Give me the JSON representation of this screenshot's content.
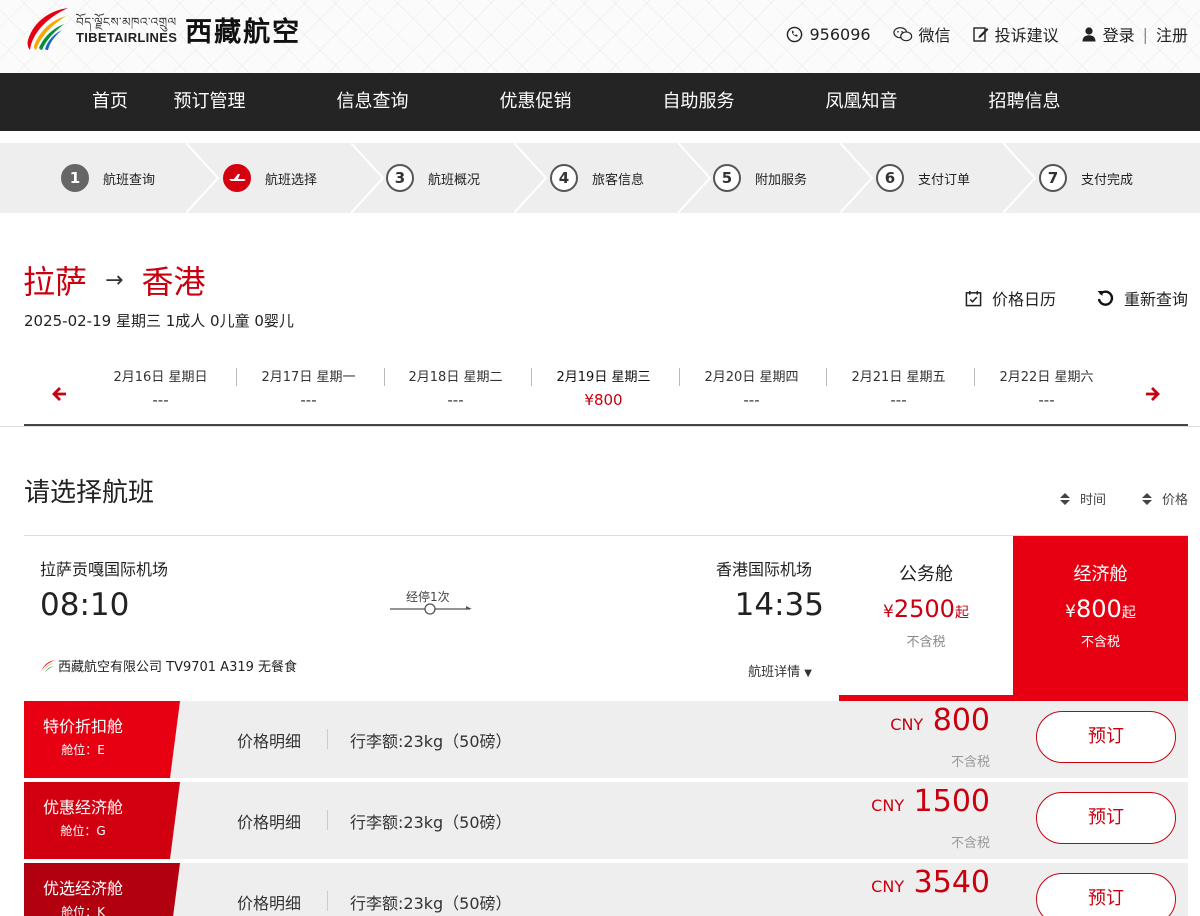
{
  "brand": {
    "tibetan": "བོད་ལྗོངས་མཁའ་འགྲུལ",
    "english": "TIBETAIRLINES",
    "chinese": "西藏航空"
  },
  "toplinks": {
    "phone": "956096",
    "wechat": "微信",
    "feedback": "投诉建议",
    "login": "登录",
    "divider": "|",
    "register": "注册"
  },
  "nav": [
    "首页",
    "预订管理",
    "信息查询",
    "优惠促销",
    "自助服务",
    "凤凰知音",
    "招聘信息"
  ],
  "steps": [
    {
      "num": "1",
      "label": "航班查询"
    },
    {
      "num": "",
      "label": "航班选择"
    },
    {
      "num": "3",
      "label": "航班概况"
    },
    {
      "num": "4",
      "label": "旅客信息"
    },
    {
      "num": "5",
      "label": "附加服务"
    },
    {
      "num": "6",
      "label": "支付订单"
    },
    {
      "num": "7",
      "label": "支付完成"
    }
  ],
  "route": {
    "from": "拉萨",
    "arrow": "→",
    "to": "香港",
    "summary": "2025-02-19 星期三 1成人 0儿童 0婴儿"
  },
  "tools": {
    "price_calendar": "价格日历",
    "requery": "重新查询"
  },
  "dates": [
    {
      "date": "2月16日 星期日",
      "price": "---"
    },
    {
      "date": "2月17日 星期一",
      "price": "---"
    },
    {
      "date": "2月18日 星期二",
      "price": "---"
    },
    {
      "date": "2月19日 星期三",
      "price": "¥800"
    },
    {
      "date": "2月20日 星期四",
      "price": "---"
    },
    {
      "date": "2月21日 星期五",
      "price": "---"
    },
    {
      "date": "2月22日 星期六",
      "price": "---"
    }
  ],
  "section": {
    "title": "请选择航班",
    "sort_time": "时间",
    "sort_price": "价格"
  },
  "flight": {
    "dep_airport": "拉萨贡嘎国际机场",
    "dep_time": "08:10",
    "arr_airport": "香港国际机场",
    "arr_time": "14:35",
    "stops": "经停1次",
    "info": "西藏航空有限公司 TV9701 A319 无餐食",
    "detail": "航班详情"
  },
  "cabins": {
    "business": {
      "name": "公务舱",
      "yen": "¥",
      "price": "2500",
      "suffix": "起",
      "tax": "不含税"
    },
    "economy": {
      "name": "经济舱",
      "yen": "¥",
      "price": "800",
      "suffix": "起",
      "tax": "不含税"
    }
  },
  "fares": [
    {
      "name": "特价折扣舱",
      "code": "舱位：E",
      "detail": "价格明细",
      "baggage": "行李额:23kg（50磅）",
      "currency": "CNY",
      "price": "800",
      "tax": "不含税",
      "book": "预订"
    },
    {
      "name": "优惠经济舱",
      "code": "舱位：G",
      "detail": "价格明细",
      "baggage": "行李额:23kg（50磅）",
      "currency": "CNY",
      "price": "1500",
      "tax": "不含税",
      "book": "预订"
    },
    {
      "name": "优选经济舱",
      "code": "舱位：K",
      "detail": "价格明细",
      "baggage": "行李额:23kg（50磅）",
      "currency": "CNY",
      "price": "3540",
      "tax": "",
      "book": "预订"
    }
  ],
  "colors": {
    "brand_red": "#e60012",
    "text_red": "#c8000f",
    "nav_bg": "#242424",
    "panel_gray": "#eeeeee"
  }
}
